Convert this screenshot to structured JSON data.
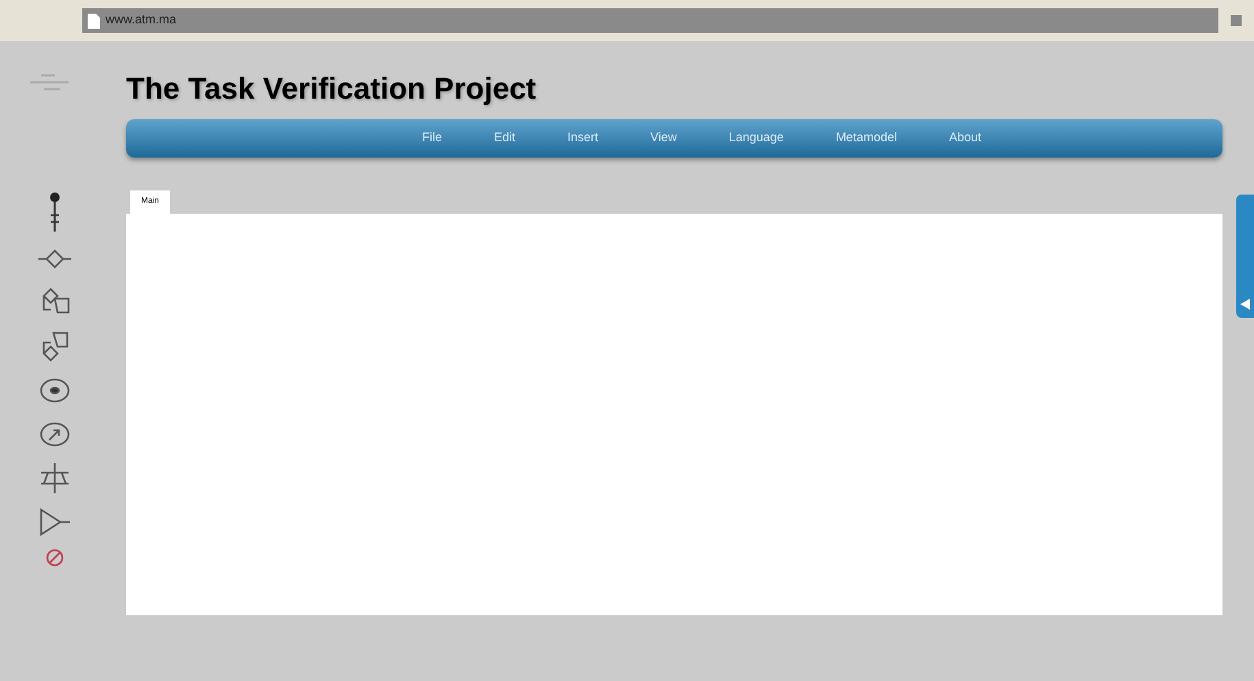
{
  "browser": {
    "url": "www.atm.ma"
  },
  "title": "The Task Verification Project",
  "menu": [
    "File",
    "Edit",
    "Insert",
    "View",
    "Language",
    "Metamodel",
    "About"
  ],
  "tabs": [
    {
      "label": "Main",
      "selected": true
    }
  ],
  "palette": [
    {
      "kind": "lollipop"
    },
    {
      "kind": "diamond"
    },
    {
      "kind": "diamond-up"
    },
    {
      "kind": "diamond-down"
    },
    {
      "kind": "ellipse"
    },
    {
      "kind": "arrow-circle"
    },
    {
      "kind": "cross"
    },
    {
      "kind": "triangle"
    },
    {
      "kind": "forbidden"
    }
  ]
}
